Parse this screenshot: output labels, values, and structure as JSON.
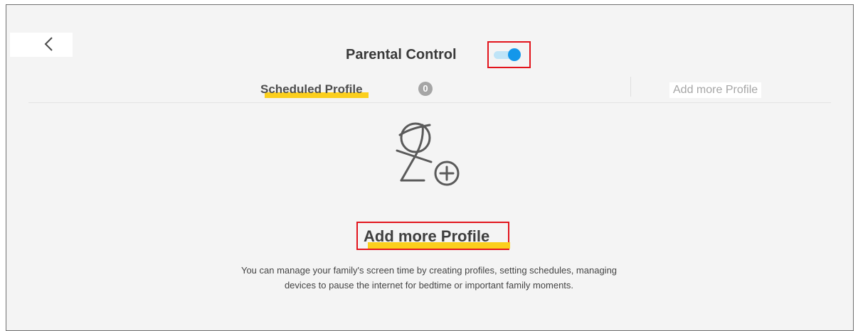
{
  "header": {
    "back_icon": "chevron-left-icon",
    "title": "Parental Control",
    "toggle": {
      "state": "on",
      "accent_color": "#1497ea",
      "track_color": "#bfe4f7"
    }
  },
  "tabs": [
    {
      "label": "Scheduled Profile",
      "count": "0",
      "active": true
    },
    {
      "label": "Add more Profile",
      "active": false
    }
  ],
  "empty_state": {
    "icon": "add-user-icon",
    "action_label": "Add more Profile",
    "description": "You can manage your family's screen time by creating profiles, setting schedules, managing devices to pause the internet for bedtime or important family moments."
  },
  "colors": {
    "highlight": "#fbcf1d",
    "annotation_box": "#e2141c",
    "background": "#f4f4f4"
  }
}
